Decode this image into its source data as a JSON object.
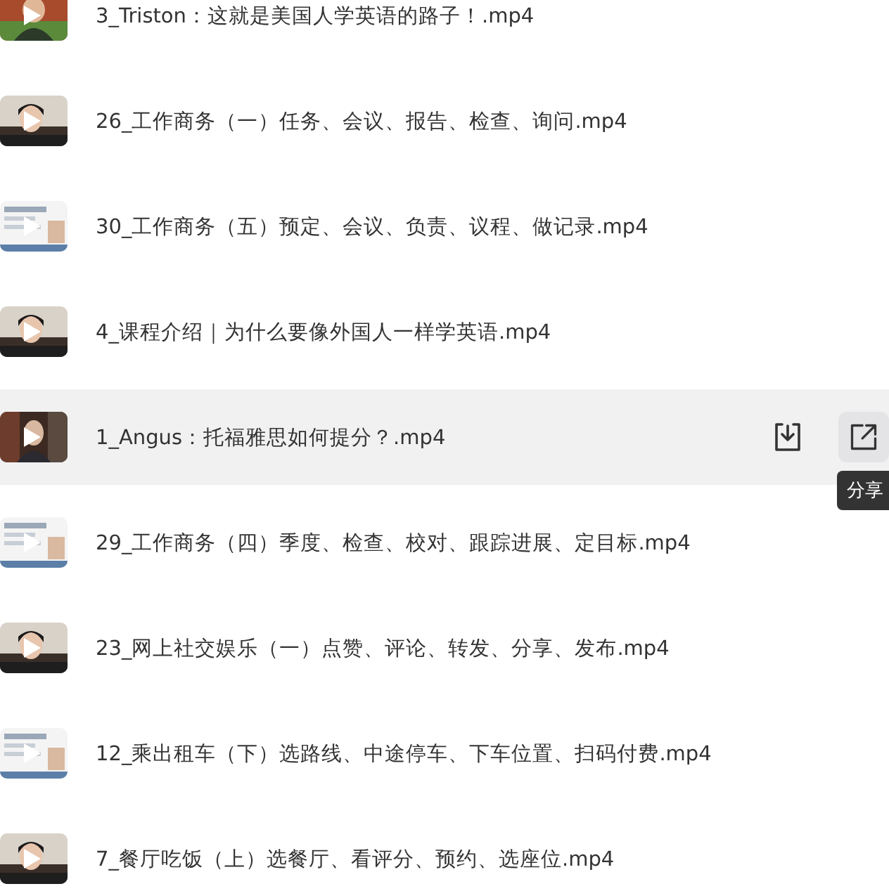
{
  "files": [
    {
      "name": "3_Triston：这就是美国人学英语的路子！.mp4",
      "hovered": false
    },
    {
      "name": "26_工作商务（一）任务、会议、报告、检查、询问.mp4",
      "hovered": false
    },
    {
      "name": "30_工作商务（五）预定、会议、负责、议程、做记录.mp4",
      "hovered": false
    },
    {
      "name": "4_课程介绍｜为什么要像外国人一样学英语.mp4",
      "hovered": false
    },
    {
      "name": "1_Angus：托福雅思如何提分？.mp4",
      "hovered": true,
      "actions": [
        {
          "kind": "download",
          "hovered": false
        },
        {
          "kind": "share",
          "hovered": true,
          "tooltip": "分享"
        }
      ]
    },
    {
      "name": "29_工作商务（四）季度、检查、校对、跟踪进展、定目标.mp4",
      "hovered": false
    },
    {
      "name": "23_网上社交娱乐（一）点赞、评论、转发、分享、发布.mp4",
      "hovered": false
    },
    {
      "name": "12_乘出租车（下）选路线、中途停车、下车位置、扫码付费.mp4",
      "hovered": false
    },
    {
      "name": "7_餐厅吃饭（上）选餐厅、看评分、预约、选座位.mp4",
      "hovered": false
    }
  ]
}
